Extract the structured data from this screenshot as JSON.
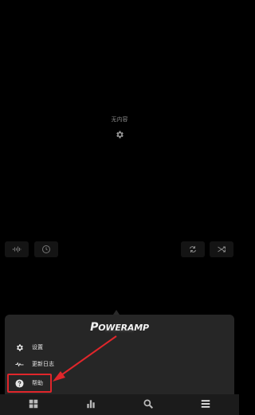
{
  "empty_state": {
    "label": "无内容"
  },
  "logo": {
    "first": "P",
    "rest": "OWERAMP"
  },
  "menu": {
    "items": [
      {
        "label": "设置",
        "icon": "gear-icon"
      },
      {
        "label": "更新日志",
        "icon": "changelog-icon"
      },
      {
        "label": "帮助",
        "icon": "help-icon"
      }
    ]
  },
  "controls": {
    "left": [
      "waveform-icon",
      "clock-icon"
    ],
    "right": [
      "repeat-icon",
      "shuffle-icon"
    ]
  },
  "bottom_nav": [
    "grid-icon",
    "bar-chart-icon",
    "search-icon",
    "menu-icon"
  ],
  "colors": {
    "highlight": "#e0262b",
    "panel": "#262626",
    "background": "#000000"
  }
}
